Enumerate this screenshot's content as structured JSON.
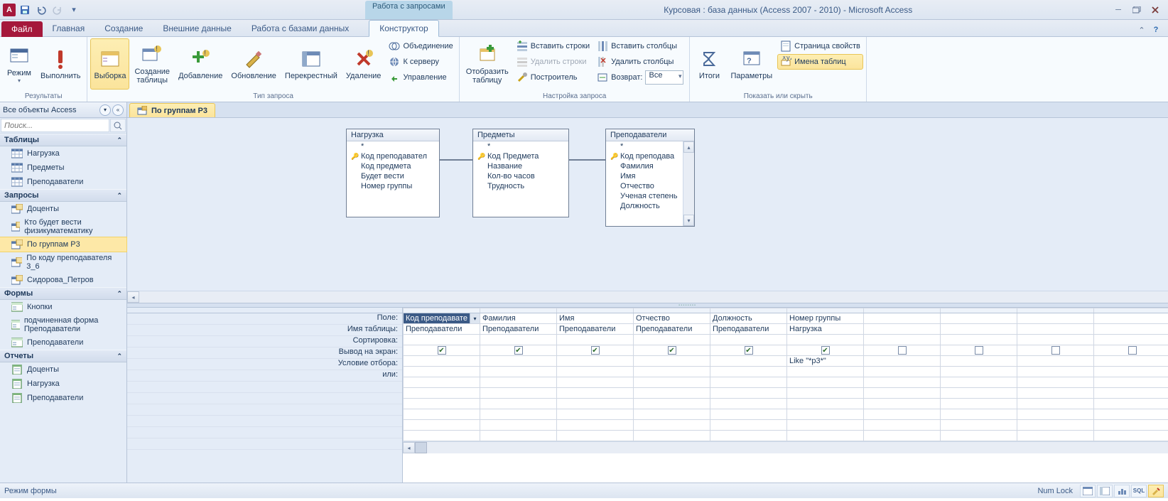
{
  "titlebar": {
    "context_group": "Работа с запросами",
    "title": "Курсовая : база данных (Access 2007 - 2010)  -  Microsoft Access"
  },
  "tabs": {
    "file": "Файл",
    "items": [
      "Главная",
      "Создание",
      "Внешние данные",
      "Работа с базами данных"
    ],
    "context": "Конструктор"
  },
  "ribbon": {
    "g1": {
      "label": "Результаты",
      "view": "Режим",
      "run": "Выполнить"
    },
    "g2": {
      "label": "Тип запроса",
      "select": "Выборка",
      "maketable": "Создание\nтаблицы",
      "append": "Добавление",
      "update": "Обновление",
      "crosstab": "Перекрестный",
      "delete": "Удаление",
      "union": "Объединение",
      "passthrough": "К серверу",
      "datadef": "Управление"
    },
    "g3": {
      "label": "Настройка запроса",
      "showtable": "Отобразить\nтаблицу",
      "insrows": "Вставить строки",
      "delrows": "Удалить строки",
      "builder": "Построитель",
      "inscols": "Вставить столбцы",
      "delcols": "Удалить столбцы",
      "return": "Возврат:",
      "return_val": "Все"
    },
    "g4": {
      "label": "Показать или скрыть",
      "totals": "Итоги",
      "params": "Параметры",
      "prop": "Страница свойств",
      "tnames": "Имена таблиц"
    }
  },
  "nav": {
    "header": "Все объекты Access",
    "search_ph": "Поиск...",
    "cats": {
      "tables": "Таблицы",
      "queries": "Запросы",
      "forms": "Формы",
      "reports": "Отчеты"
    },
    "tables": [
      "Нагрузка",
      "Предметы",
      "Преподаватели"
    ],
    "queries": [
      "Доценты",
      "Кто будет вести физикуматематику",
      "По группам Р3",
      "По коду преподавателя 3_6",
      "Сидорова_Петров"
    ],
    "forms": [
      "Кнопки",
      "подчиненная форма Преподаватели",
      "Преподаватели"
    ],
    "reports": [
      "Доценты",
      "Нагрузка",
      "Преподаватели"
    ]
  },
  "doc": {
    "tab": "По группам Р3"
  },
  "design_tables": {
    "t1": {
      "title": "Нагрузка",
      "fields": [
        "*",
        "Код преподавател",
        "Код предмета",
        "Будет вести",
        "Номер группы"
      ],
      "key_idx": 1
    },
    "t2": {
      "title": "Предметы",
      "fields": [
        "*",
        "Код Предмета",
        "Название",
        "Кол-во часов",
        "Трудность"
      ],
      "key_idx": 1
    },
    "t3": {
      "title": "Преподаватели",
      "fields": [
        "*",
        "Код преподава",
        "Фамилия",
        "Имя",
        "Отчество",
        "Ученая степень",
        "Должность"
      ],
      "key_idx": 1
    }
  },
  "qbe": {
    "row_labels": [
      "Поле:",
      "Имя таблицы:",
      "Сортировка:",
      "Вывод на экран:",
      "Условие отбора:",
      "или:"
    ],
    "cols": [
      {
        "field": "Код преподавате",
        "table": "Преподаватели",
        "show": true,
        "crit": "",
        "selected": true
      },
      {
        "field": "Фамилия",
        "table": "Преподаватели",
        "show": true,
        "crit": ""
      },
      {
        "field": "Имя",
        "table": "Преподаватели",
        "show": true,
        "crit": ""
      },
      {
        "field": "Отчество",
        "table": "Преподаватели",
        "show": true,
        "crit": ""
      },
      {
        "field": "Должность",
        "table": "Преподаватели",
        "show": true,
        "crit": ""
      },
      {
        "field": "Номер группы",
        "table": "Нагрузка",
        "show": true,
        "crit": "Like \"*р3*\""
      },
      {
        "field": "",
        "table": "",
        "show": false,
        "crit": ""
      },
      {
        "field": "",
        "table": "",
        "show": false,
        "crit": ""
      },
      {
        "field": "",
        "table": "",
        "show": false,
        "crit": ""
      },
      {
        "field": "",
        "table": "",
        "show": false,
        "crit": ""
      },
      {
        "field": "",
        "table": "",
        "show": false,
        "crit": ""
      }
    ]
  },
  "status": {
    "left": "Режим формы",
    "numlock": "Num Lock"
  }
}
